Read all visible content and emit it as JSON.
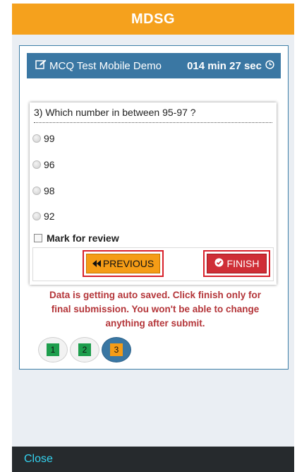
{
  "header": {
    "title": "MDSG"
  },
  "test_bar": {
    "title": "MCQ Test Mobile Demo",
    "timer": "014 min 27 sec"
  },
  "question": {
    "text": "3) Which number in between 95-97 ?",
    "options": [
      "99",
      "96",
      "98",
      "92"
    ],
    "mark_for_review": "Mark for review"
  },
  "buttons": {
    "previous": "PREVIOUS",
    "finish": "FINISH"
  },
  "notice": "Data is getting auto saved. Click finish only for final submission. You won't be able to change anything after submit.",
  "pager": {
    "pages": [
      "1",
      "2",
      "3"
    ],
    "current": "3"
  },
  "footer": {
    "close": "Close"
  },
  "colors": {
    "header": "#f5a11d",
    "test_bar": "#3a77a3",
    "previous_button": "#f59c16",
    "finish_button": "#cf2e36",
    "notice_text": "#b43539",
    "answered_page": "#1e9e4d",
    "footer": "#262a2d",
    "close_link": "#34d3f0"
  },
  "icons": {
    "test_title": "edit-icon",
    "timer": "clock-icon",
    "previous": "double-chevron-left-icon",
    "finish": "check-circle-icon"
  }
}
